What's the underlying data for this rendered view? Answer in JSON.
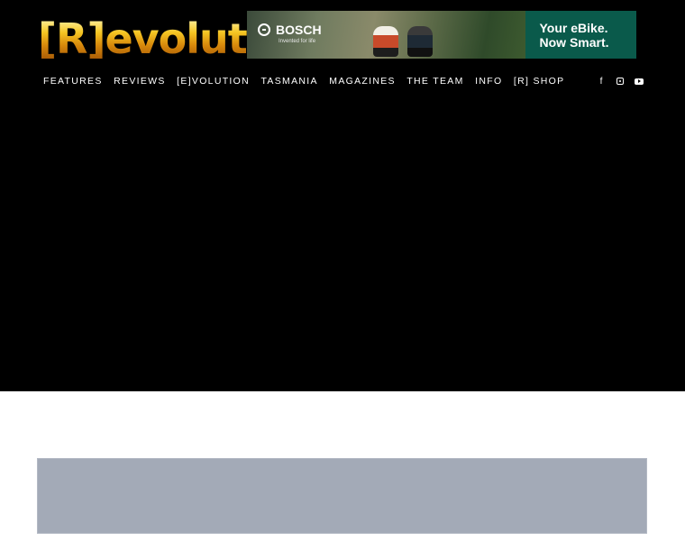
{
  "logo": {
    "text": "[R]evolution"
  },
  "ad": {
    "brand": "BOSCH",
    "slogan": "Invented for life",
    "cta_line1": "Your eBike.",
    "cta_line2": "Now Smart.",
    "cta_color": "#0a5a4b"
  },
  "nav": {
    "items": [
      "FEATURES",
      "REVIEWS",
      "[E]VOLUTION",
      "TASMANIA",
      "MAGAZINES",
      "THE TEAM",
      "INFO",
      "[R] SHOP"
    ]
  },
  "social": {
    "facebook_glyph": "f"
  },
  "colors": {
    "hero": "#000000",
    "placeholder": "#a3aab7",
    "logo_gold": "#f5c623"
  }
}
